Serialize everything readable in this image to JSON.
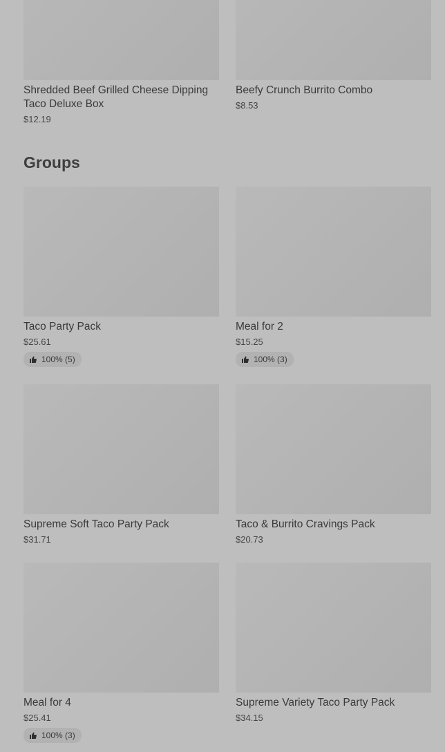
{
  "top_items": [
    {
      "name": "Shredded Beef Grilled Cheese Dipping Taco Deluxe Box",
      "price": "$12.19"
    },
    {
      "name": "Beefy Crunch Burrito Combo",
      "price": "$8.53"
    }
  ],
  "groups": {
    "title": "Groups",
    "items": [
      {
        "name": "Taco Party Pack",
        "price": "$25.61",
        "rating": "100% (5)"
      },
      {
        "name": "Meal for 2",
        "price": "$15.25",
        "rating": "100% (3)"
      },
      {
        "name": "Supreme Soft Taco Party Pack",
        "price": "$31.71"
      },
      {
        "name": "Taco & Burrito Cravings Pack",
        "price": "$20.73"
      },
      {
        "name": "Meal for 4",
        "price": "$25.41",
        "rating": "100% (3)"
      },
      {
        "name": "Supreme Variety Taco Party Pack",
        "price": "$34.15"
      }
    ]
  },
  "icons": {
    "rating": "thumbs-up-icon"
  }
}
